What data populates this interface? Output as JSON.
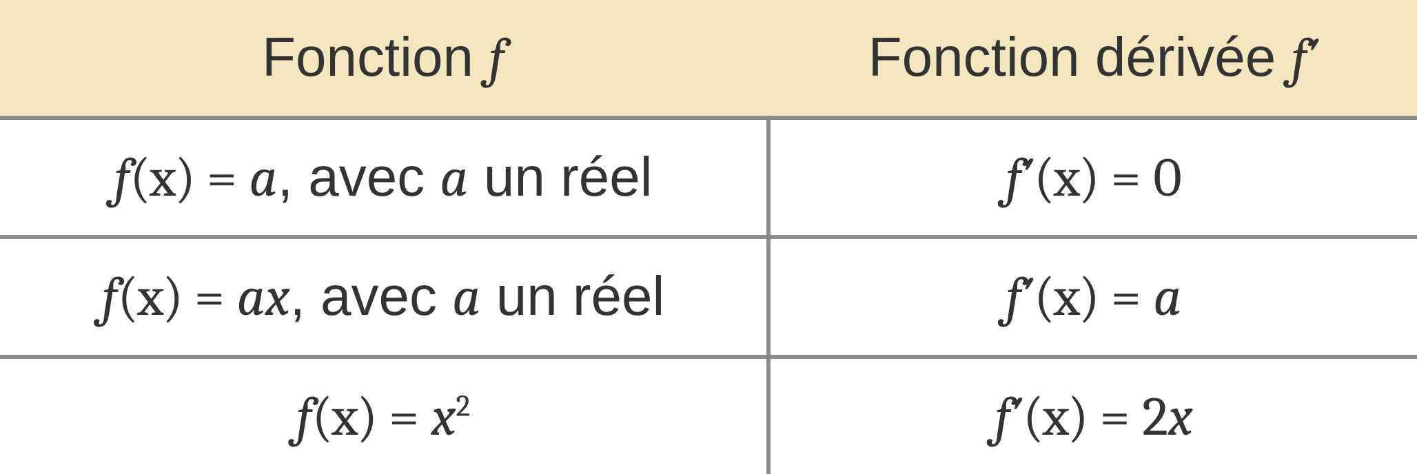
{
  "chart_data": {
    "type": "table",
    "columns": [
      "Fonction f",
      "Fonction dérivée f′"
    ],
    "rows": [
      [
        "f(x) = a, avec a un réel",
        "f′(x) = 0"
      ],
      [
        "f(x) = ax, avec a un réel",
        "f′(x) = a"
      ],
      [
        "f(x) = x²",
        "f′(x) = 2x"
      ]
    ]
  },
  "table": {
    "headers": {
      "col1_prefix": "Fonction ",
      "col1_symbol": "f",
      "col2_prefix": "Fonction dérivée ",
      "col2_symbol": "f′"
    },
    "rows": [
      {
        "left": {
          "lhs": "f",
          "args": "(x)",
          "eq": " = ",
          "rhs": "a",
          "suffix_plain": ", avec ",
          "suffix_var": "a",
          "suffix_tail": " un réel"
        },
        "right": {
          "lhs": "f′",
          "args": "(x)",
          "eq": " = ",
          "rhs": "0"
        }
      },
      {
        "left": {
          "lhs": "f",
          "args": "(x)",
          "eq": " = ",
          "rhs": "ax",
          "suffix_plain": ", avec ",
          "suffix_var": "a",
          "suffix_tail": " un réel"
        },
        "right": {
          "lhs": "f′",
          "args": "(x)",
          "eq": " = ",
          "rhs": "a"
        }
      },
      {
        "left": {
          "lhs": "f",
          "args": "(x)",
          "eq": " = ",
          "rhs_base": "x",
          "rhs_sup": "2"
        },
        "right": {
          "lhs": "f′",
          "args": "(x)",
          "eq": " = ",
          "rhs_coef": "2",
          "rhs_var": "x"
        }
      }
    ]
  }
}
